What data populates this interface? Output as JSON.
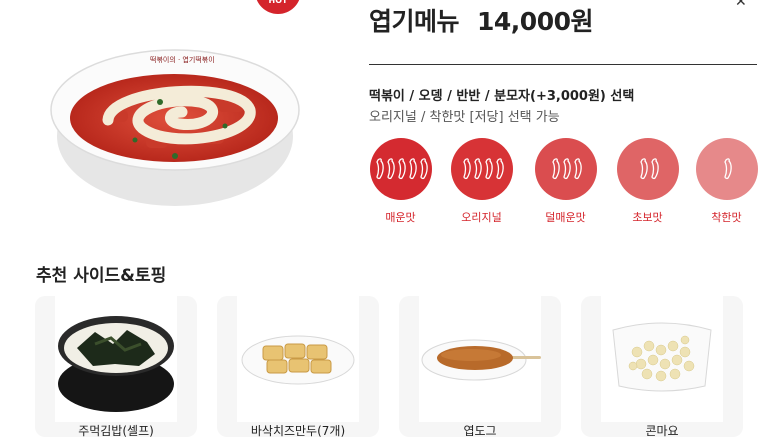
{
  "badge": {
    "hot": "HOT"
  },
  "product": {
    "name": "엽기메뉴",
    "price": "14,000원"
  },
  "options": {
    "line1": "떡볶이 / 오뎅 / 반반 / 분모자(+3,000원) 선택",
    "line2": "오리지널 / 착한맛 [저당] 선택 가능"
  },
  "spice_levels": [
    {
      "label": "매운맛",
      "peppers": 5,
      "color": "#d42a30"
    },
    {
      "label": "오리지널",
      "peppers": 4,
      "color": "#d73336"
    },
    {
      "label": "덜매운맛",
      "peppers": 3,
      "color": "#da4d4f"
    },
    {
      "label": "초보맛",
      "peppers": 2,
      "color": "#df6566"
    },
    {
      "label": "착한맛",
      "peppers": 1,
      "color": "#e6898a"
    }
  ],
  "side_section": {
    "title": "추천 사이드&토핑"
  },
  "sides": [
    {
      "name": "주먹김밥(셀프)"
    },
    {
      "name": "바삭치즈만두(7개)"
    },
    {
      "name": "엽도그"
    },
    {
      "name": "콘마요"
    }
  ],
  "icons": {
    "pepper": "chili-pepper-icon",
    "close": "close-icon"
  },
  "colors": {
    "accent": "#d4242b"
  }
}
